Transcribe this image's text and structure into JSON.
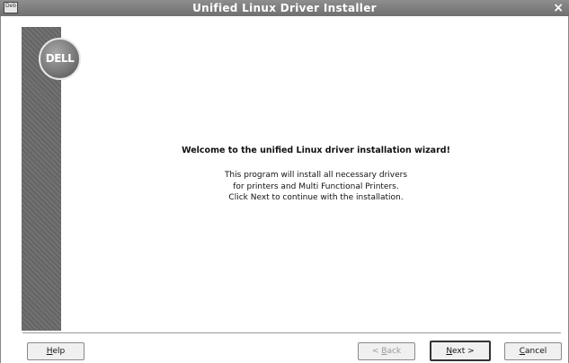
{
  "window": {
    "title": "Unified Linux Driver Installer",
    "app_icon_text": "Deb",
    "close_glyph": "×"
  },
  "brand": {
    "logo_text": "DELL"
  },
  "wizard": {
    "heading": "Welcome to the unified Linux driver installation wizard!",
    "description_lines": [
      "This program will install all necessary drivers",
      "for printers and Multi Functional Printers.",
      "Click Next to continue with the installation."
    ]
  },
  "buttons": {
    "help": {
      "mnemonic": "H",
      "rest": "elp"
    },
    "back": {
      "prefix": "< ",
      "mnemonic": "B",
      "rest": "ack"
    },
    "next": {
      "mnemonic": "N",
      "rest": "ext >"
    },
    "cancel": {
      "mnemonic": "C",
      "rest": "ancel"
    }
  },
  "colors": {
    "titlebar": "#7f7f7f",
    "side_panel": "#6a6a6a",
    "window_bg": "#ffffff"
  }
}
